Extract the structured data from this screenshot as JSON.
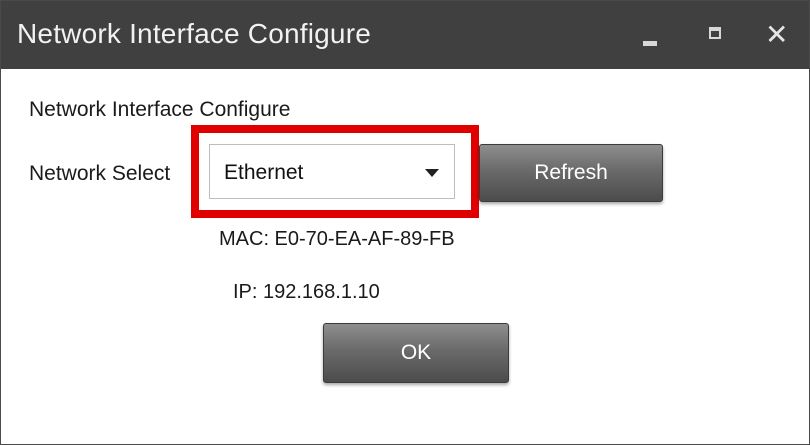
{
  "window": {
    "title": "Network Interface Configure",
    "controls": {
      "minimize_icon": "minimize-icon",
      "maximize_icon": "maximize-icon",
      "close_glyph": "✕"
    }
  },
  "main": {
    "heading": "Network Interface Configure",
    "network_select_label": "Network Select",
    "network_select_value": "Ethernet",
    "refresh_label": "Refresh",
    "mac_text": "MAC: E0-70-EA-AF-89-FB",
    "ip_text": "IP: 192.168.1.10",
    "ok_label": "OK"
  },
  "colors": {
    "titlebar": "#404040",
    "highlight": "#e00000",
    "button": "#6a6a6a"
  }
}
